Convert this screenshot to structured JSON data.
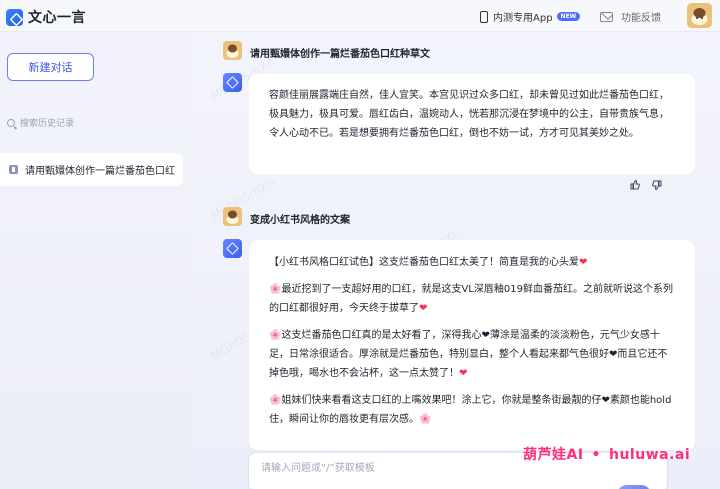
{
  "header": {
    "logo_text": "文心一言",
    "app_label": "内测专用App",
    "app_badge": "NEW",
    "feedback_label": "功能反馈"
  },
  "sidebar": {
    "new_chat_label": "新建对话",
    "search_placeholder": "搜索历史记录",
    "history": [
      {
        "label": "请用甄嬛体创作一篇烂番茄色口红"
      }
    ]
  },
  "conversation": [
    {
      "question": "请用甄嬛体创作一篇烂番茄色口红种草文",
      "answer": "容颜佳丽展露端庄自然，佳人宜笑。本宫见识过众多口红，却未曾见过如此烂番茄色口红，极具魅力，极具可爱。唇红齿白，温婉动人，恍若那沉浸在梦境中的公主，自带贵族气息，令人心动不已。若是想要拥有烂番茄色口红，倒也不妨一试，方才可见其美妙之处。"
    },
    {
      "question": "变成小红书风格的文案",
      "paragraphs": [
        {
          "text": "【小红书风格口红试色】这支烂番茄色口红太美了！简直是我的心头爱",
          "tail": "❤"
        },
        {
          "lead": "🌸",
          "text": "最近挖到了一支超好用的口红，就是这支VL深唇釉019鲜血番茄红。之前就听说这个系列的口红都很好用，今天终于拔草了",
          "tail": "❤"
        },
        {
          "lead": "🌸",
          "text": "这支烂番茄色口红真的是太好看了，深得我心❤薄涂是温柔的淡淡粉色，元气少女感十足，日常涂很适合。厚涂就是烂番茄色，特别显白，整个人看起来都气色很好❤而且它还不掉色哦，喝水也不会沾杯，这一点太赞了！",
          "tail": "❤"
        },
        {
          "lead": "🌸",
          "text": "姐妹们快来看看这支口红的上嘴效果吧！涂上它，你就是整条街最靓的仔❤素颜也能hold住，瞬间让你的唇妆更有层次感。",
          "tail": "🌸"
        }
      ]
    }
  ],
  "input": {
    "placeholder": "请输入问题或“/”获取模板"
  },
  "watermark": {
    "left": "葫芦娃AI",
    "right": "huluwa.ai",
    "tile": "MGhD5mXn"
  },
  "colors": {
    "accent": "#4f6ef7",
    "watermark": "#ff2f7a"
  }
}
